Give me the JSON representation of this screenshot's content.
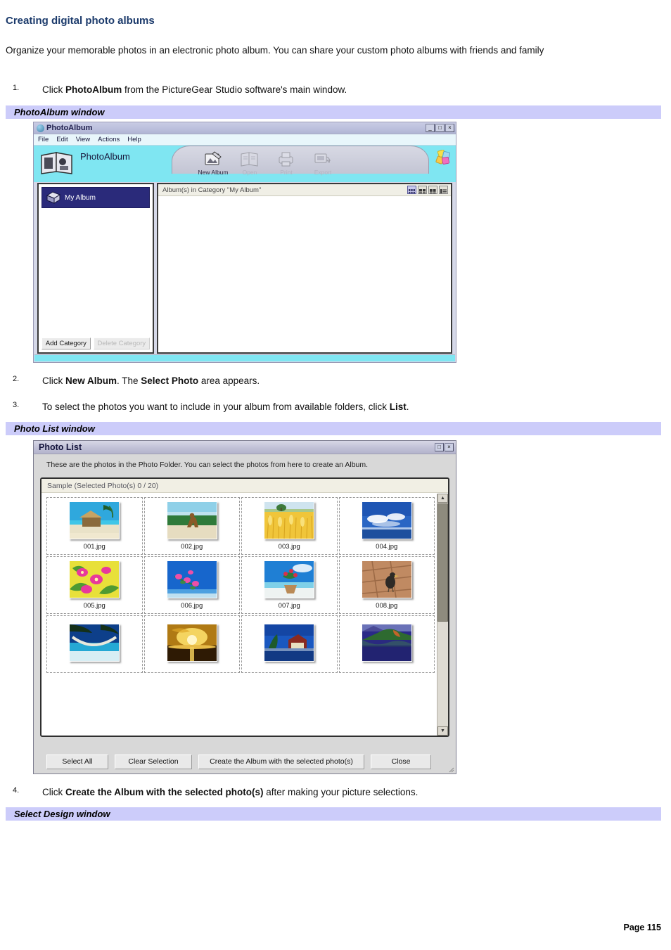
{
  "document": {
    "title": "Creating digital photo albums",
    "intro": "Organize your memorable photos in an electronic photo album. You can share your custom photo albums with friends and family",
    "page_footer": "Page 115",
    "accent_heading_color": "#1b3a6b",
    "caption_bar_color": "#ccccfa"
  },
  "steps": [
    {
      "num": "1.",
      "prefix": "Click ",
      "bold1": "PhotoAlbum",
      "mid": " from the PictureGear Studio ",
      "suffix": "  software's main window."
    },
    {
      "num": "2.",
      "prefix": "Click ",
      "bold1": "New Album",
      "mid": ". The ",
      "bold2": "Select Photo",
      "suffix": " area appears."
    },
    {
      "num": "3.",
      "prefix": "To select the photos you want to include in your album from available folders, click ",
      "bold1": "List",
      "suffix": "."
    },
    {
      "num": "4.",
      "prefix": "Click ",
      "bold1": "Create the Album with the selected photo(s)",
      "suffix": " after making your picture selections."
    }
  ],
  "captions": {
    "photoalbum_window": "PhotoAlbum window",
    "photo_list_window": "Photo List window",
    "select_design_window": "Select Design window"
  },
  "photoalbum_window": {
    "title": "PhotoAlbum",
    "window_buttons": [
      "_",
      "□",
      "×"
    ],
    "menus": [
      "File",
      "Edit",
      "View",
      "Actions",
      "Help"
    ],
    "banner_label": "PhotoAlbum",
    "toolbar": [
      {
        "label": "New Album",
        "icon": "new-album-icon",
        "enabled": true
      },
      {
        "label": "Open",
        "icon": "open-icon",
        "enabled": false
      },
      {
        "label": "Print",
        "icon": "print-icon",
        "enabled": false
      },
      {
        "label": "Export",
        "icon": "export-icon",
        "enabled": false
      }
    ],
    "sidebar": {
      "category": "My Album",
      "add_button": "Add Category",
      "delete_button": "Delete Category",
      "delete_enabled": false
    },
    "main": {
      "header": "Album(s) in Category \"My Album\"",
      "view_buttons": [
        "view-large-icon",
        "view-grid-icon",
        "view-tile-icon",
        "view-list-icon"
      ],
      "active_view_index": 0
    }
  },
  "photo_list_window": {
    "title": "Photo List",
    "window_buttons": [
      "□",
      "×"
    ],
    "description": "These are the photos in the Photo Folder.  You can select the photos from here to create an Album.",
    "folder_header": "Sample (Selected Photo(s) 0 / 20)",
    "photos": [
      {
        "name": "001.jpg",
        "subject": "beach-hut-palm"
      },
      {
        "name": "002.jpg",
        "subject": "dog-on-beach"
      },
      {
        "name": "003.jpg",
        "subject": "wheat-field"
      },
      {
        "name": "004.jpg",
        "subject": "clouds-over-sea"
      },
      {
        "name": "005.jpg",
        "subject": "pink-flowers-yellow"
      },
      {
        "name": "006.jpg",
        "subject": "pink-blossoms-blue-sky"
      },
      {
        "name": "007.jpg",
        "subject": "potted-plant-beach"
      },
      {
        "name": "008.jpg",
        "subject": "bird-on-bricks"
      },
      {
        "name": "",
        "subject": "hammock-beach"
      },
      {
        "name": "",
        "subject": "golden-sunset-sea"
      },
      {
        "name": "",
        "subject": "lakeside-house"
      },
      {
        "name": "",
        "subject": "autumn-lake-reflection"
      }
    ],
    "buttons": [
      "Select All",
      "Clear Selection",
      "Create the Album with the selected photo(s)",
      "Close"
    ]
  }
}
